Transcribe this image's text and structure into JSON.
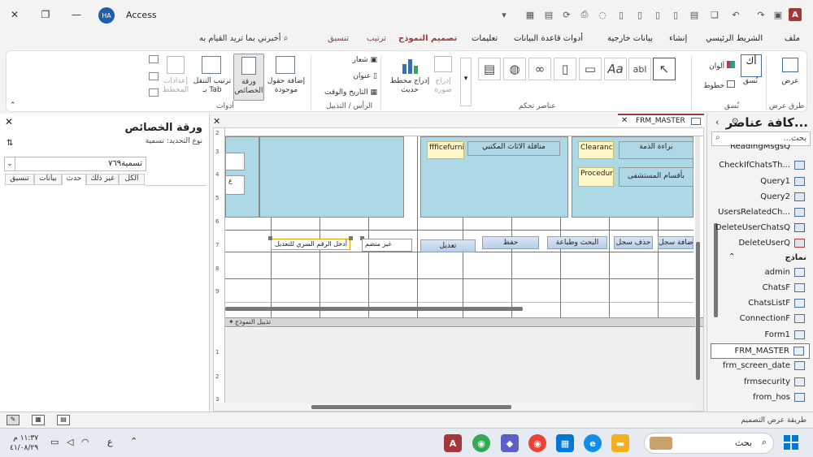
{
  "window": {
    "app_title": "Access",
    "user_initials": "HA",
    "logo_letter": "A"
  },
  "ribbon_tabs": [
    {
      "label": "ملف"
    },
    {
      "label": "الشريط الرئيسي"
    },
    {
      "label": "إنشاء"
    },
    {
      "label": "بيانات خارجية"
    },
    {
      "label": "أدوات قاعدة البيانات"
    },
    {
      "label": "تعليمات"
    },
    {
      "label": "تصميم النموذج"
    },
    {
      "label": "ترتيب"
    },
    {
      "label": "تنسيق"
    }
  ],
  "tell_me": "أخبرني بما تريد القيام به",
  "ribbon": {
    "views": {
      "button": "عرض",
      "group": "طرق عرض"
    },
    "themes": {
      "button": "نُسق",
      "colors": "ألوان",
      "fonts": "خطوط",
      "group": "نُسق"
    },
    "controls": {
      "group": "عناصر تحكم",
      "insert_image": "إدراج صورة",
      "insert_chart": "إدراج مخطط حديث",
      "gallery_text": "Aa",
      "gallery_label": "abl"
    },
    "header_footer": {
      "group": "الرأس / التذييل",
      "logo": "شعار",
      "title": "عنوان",
      "datetime": "التاريخ والوقت"
    },
    "tools": {
      "group": "أدوات",
      "add_fields": "إضافة حقول موجودة",
      "property_sheet": "ورقة الخصائص",
      "tab_order": "ترتيب التنقل بـ Tab",
      "chart_settings": "إعدادات المخطط"
    }
  },
  "nav_pane": {
    "title": "كافة عناصر...",
    "search_placeholder": "بحث...",
    "queries": [
      "ReadingMsgsQ",
      "CheckIfChatsTh...",
      "Query1",
      "Query2",
      "UsersRelatedCh...",
      "DeleteUserChatsQ",
      "DeleteUserQ"
    ],
    "forms_header": "نماذج",
    "forms": [
      "admin",
      "ChatsF",
      "ChatsListF",
      "ConnectionF",
      "Form1",
      "FRM_MASTER",
      "frm_screen_date",
      "frmsecurity",
      "from_hos"
    ],
    "selected_form": "FRM_MASTER"
  },
  "document": {
    "tab_label": "FRM_MASTER",
    "footer_section": "تذييل النموذج",
    "controls": {
      "furniture_label": "ffficefurnitu",
      "furniture_button": "مناقلة الاثاث المكتبي",
      "clearance_label": "Clearance",
      "clearance_button": "براءة الذمة",
      "procedures_label": "Procedures",
      "procedures_button": "بأقسام المستشفى",
      "unbound_text": "غير منضم",
      "edit_button": "تعديل",
      "save_button": "حفظ",
      "search_print_button": "البحث وطباعة",
      "delete_button": "حذف سجل",
      "add_button": "إضافة سجل",
      "selected_textbox": "أدخل الرقم السري للتعديل"
    },
    "ruler_numbers": [
      "2",
      "3",
      "4",
      "5",
      "6",
      "7",
      "8",
      "9"
    ],
    "ruler_footer_numbers": [
      "1",
      "2",
      "3"
    ]
  },
  "property_sheet": {
    "title": "ورقة الخصائص",
    "selection_type": "نوع التحديد: تسمية",
    "combo_value": "تسمية٧٦٩",
    "tabs": [
      "الكل",
      "غير ذلك",
      "حدث",
      "بيانات",
      "تنسيق"
    ],
    "active_tab": "حدث"
  },
  "status_bar": {
    "text": "طريقة عرض التصميم"
  },
  "taskbar": {
    "search_placeholder": "بحث",
    "time": "١١:٣٧ م",
    "date": "٤١/٠٨/٢٩",
    "lang": "ع"
  },
  "colors": {
    "accent": "#a4373a",
    "panel_blue": "#add8e6"
  }
}
